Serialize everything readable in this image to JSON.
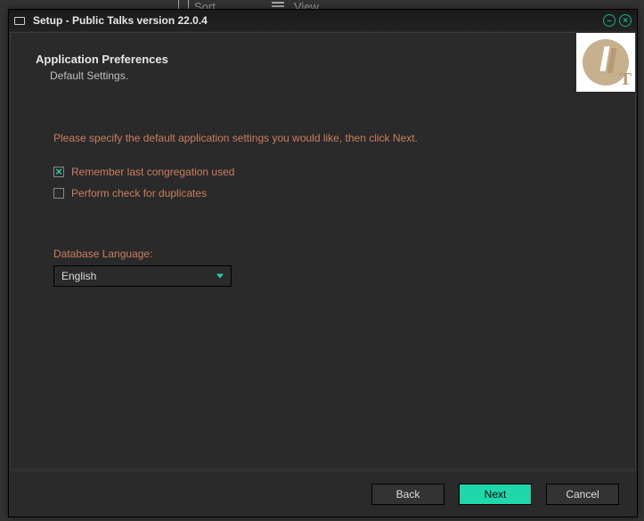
{
  "titlebar": {
    "title": "Setup - Public Talks version 22.0.4"
  },
  "background": {
    "sort": "Sort",
    "view": "View"
  },
  "header": {
    "title": "Application Preferences",
    "subtitle": "Default Settings."
  },
  "logo": {
    "letter": "T"
  },
  "body": {
    "instruction": "Please specify the default application settings you would like, then click Next.",
    "checkboxes": [
      {
        "label": "Remember last congregation used",
        "checked": true
      },
      {
        "label": "Perform check for duplicates",
        "checked": false
      }
    ],
    "language": {
      "label": "Database Language:",
      "value": "English"
    }
  },
  "footer": {
    "back": "Back",
    "next": "Next",
    "cancel": "Cancel"
  }
}
